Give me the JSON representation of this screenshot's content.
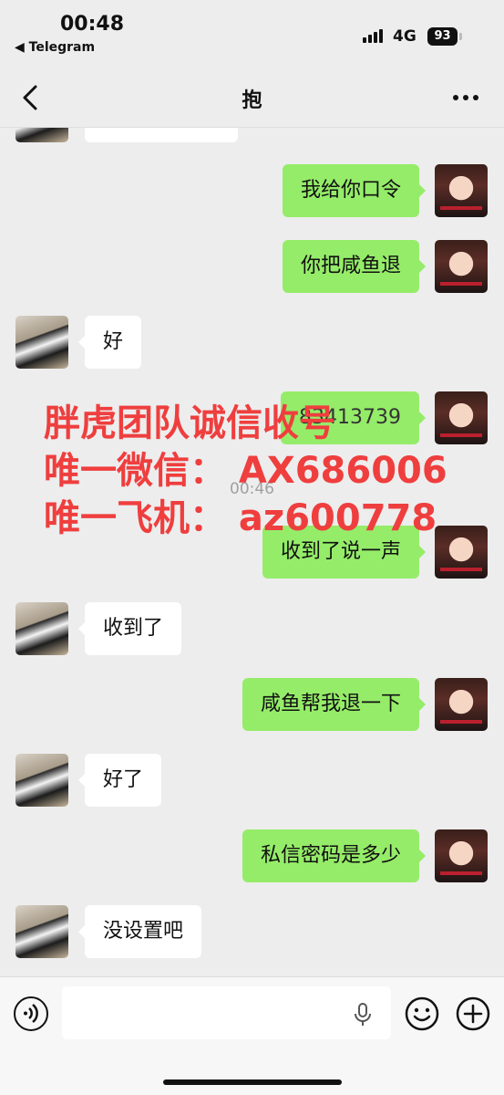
{
  "status_bar": {
    "time": "00:48",
    "back_app": "◀ Telegram",
    "network": "4G",
    "battery": "93"
  },
  "header": {
    "title": "抱"
  },
  "chat": {
    "messages": [
      {
        "side": "out",
        "text": "我给你口令"
      },
      {
        "side": "out",
        "text": "你把咸鱼退"
      },
      {
        "side": "in",
        "text": "好"
      },
      {
        "side": "out",
        "text": "83413739"
      },
      {
        "side": "out",
        "text": "收到了说一声"
      },
      {
        "side": "in",
        "text": "收到了"
      },
      {
        "side": "out",
        "text": "咸鱼帮我退一下"
      },
      {
        "side": "in",
        "text": "好了"
      },
      {
        "side": "out",
        "text": "私信密码是多少"
      },
      {
        "side": "in",
        "text": "没设置吧"
      }
    ],
    "timestamp": "00:46"
  },
  "watermark": {
    "line1": "胖虎团队诚信收号",
    "line2": "唯一微信： AX686006",
    "line3": "唯一飞机：  az600778",
    "color": "#ef3e3e"
  },
  "input_bar": {
    "placeholder": ""
  },
  "colors": {
    "outgoing_bubble": "#95ec69",
    "incoming_bubble": "#ffffff",
    "background": "#ededed"
  },
  "icons": [
    "chevron-left-icon",
    "more-dots-icon",
    "voice-icon",
    "microphone-icon",
    "emoji-icon",
    "plus-icon"
  ]
}
